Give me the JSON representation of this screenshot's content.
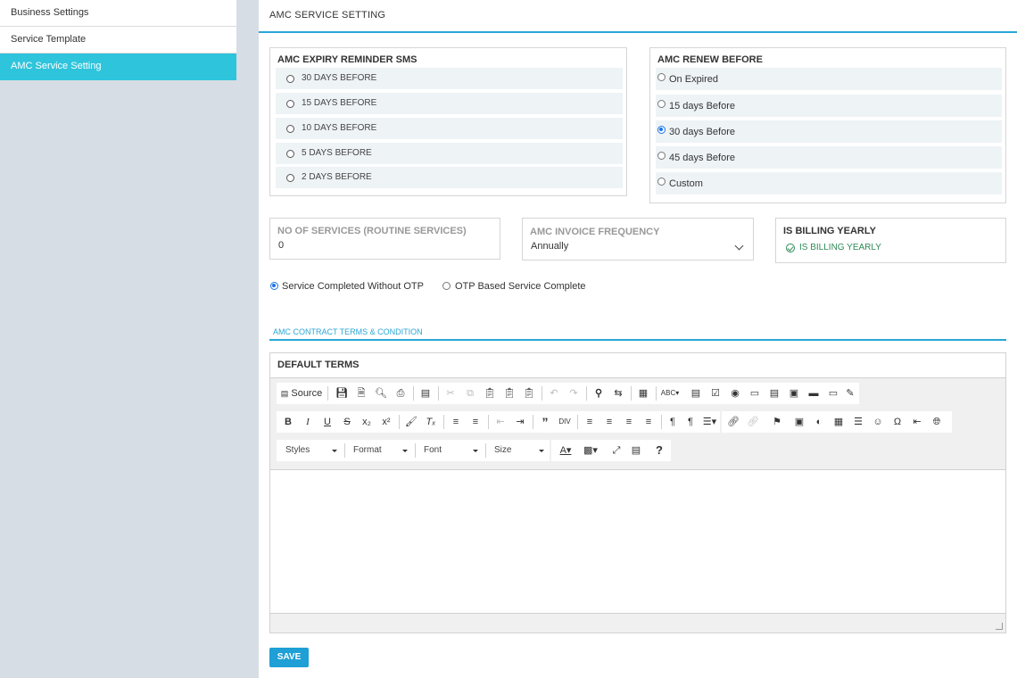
{
  "sidebar": {
    "items": [
      {
        "label": "Business Settings"
      },
      {
        "label": "Service Template"
      },
      {
        "label": "AMC Service Setting"
      }
    ]
  },
  "page": {
    "title": "AMC SERVICE SETTING"
  },
  "reminder_sms": {
    "title": "AMC EXPIRY REMINDER SMS",
    "options": [
      "30 DAYS BEFORE",
      "15 DAYS BEFORE",
      "10 DAYS BEFORE",
      "5 DAYS BEFORE",
      "2 DAYS BEFORE"
    ]
  },
  "renew_before": {
    "title": "AMC RENEW BEFORE",
    "options": [
      "On Expired",
      "15 days Before",
      "30 days Before",
      "45 days Before",
      "Custom"
    ],
    "selected": "30 days Before"
  },
  "services": {
    "label": "NO OF SERVICES (ROUTINE SERVICES)",
    "value": "0"
  },
  "invoice_frequency": {
    "label": "AMC INVOICE FREQUENCY",
    "value": "Annually"
  },
  "billing": {
    "title": "IS BILLING YEARLY",
    "value": "IS BILLING YEARLY",
    "color": "#2e8b57"
  },
  "completion": {
    "options": [
      "Service Completed Without OTP",
      "OTP Based Service Complete"
    ],
    "selected": "Service Completed Without OTP"
  },
  "terms_tab": {
    "label": "AMC CONTRACT TERMS & CONDITION"
  },
  "editor": {
    "title": "DEFAULT TERMS",
    "source_label": "Source",
    "combos": {
      "styles": "Styles",
      "format": "Format",
      "font": "Font",
      "size": "Size"
    },
    "help_label": "?"
  },
  "save": {
    "label": "SAVE"
  },
  "colors": {
    "accent": "#2aa6d6",
    "sidebar_active": "#2ec4dc",
    "sidebar_bg": "#d7dde4"
  }
}
